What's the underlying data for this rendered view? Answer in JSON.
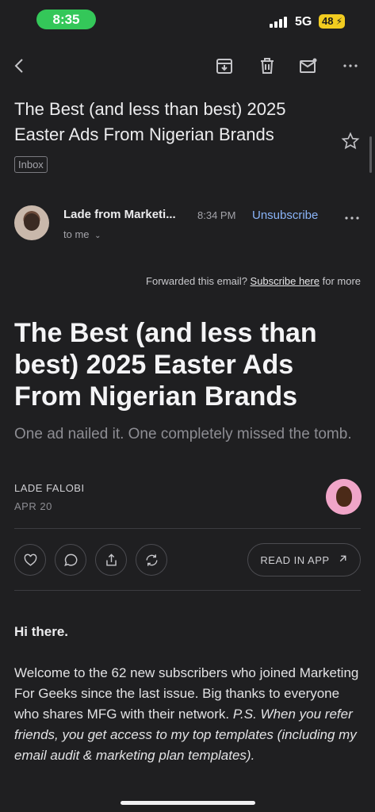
{
  "status": {
    "time": "8:35",
    "network": "5G",
    "battery": "48"
  },
  "toolbar": {
    "back_icon": "back-arrow-icon",
    "archive_icon": "archive-icon",
    "delete_icon": "trash-icon",
    "unread_icon": "mark-unread-icon",
    "more_icon": "more-horizontal-icon"
  },
  "email": {
    "subject": "The Best (and less than best) 2025 Easter Ads From Nigerian Brands",
    "label": "Inbox",
    "sender_name": "Lade from Marketi...",
    "time": "8:34 PM",
    "unsubscribe": "Unsubscribe",
    "to": "to me",
    "forward_prefix": "Forwarded this email? ",
    "forward_link": "Subscribe here",
    "forward_suffix": " for more"
  },
  "article": {
    "headline": "The Best (and less than best) 2025 Easter Ads From Nigerian Brands",
    "subtitle": "One ad nailed it. One completely missed the tomb.",
    "author": "LADE FALOBI",
    "date": "APR 20",
    "read_in_app": "READ IN APP"
  },
  "body": {
    "greeting": "Hi there.",
    "para_main": "Welcome to the 62 new subscribers who joined Marketing For Geeks since the last issue. Big thanks to everyone who shares MFG with their network. ",
    "para_italic": "P.S. When you refer friends, you get access to my top templates (including my email audit & marketing plan templates)."
  },
  "colors": {
    "link": "#8ab4f8",
    "status_pill": "#34c759",
    "battery": "#f2cc20",
    "background": "#1f1f21"
  }
}
